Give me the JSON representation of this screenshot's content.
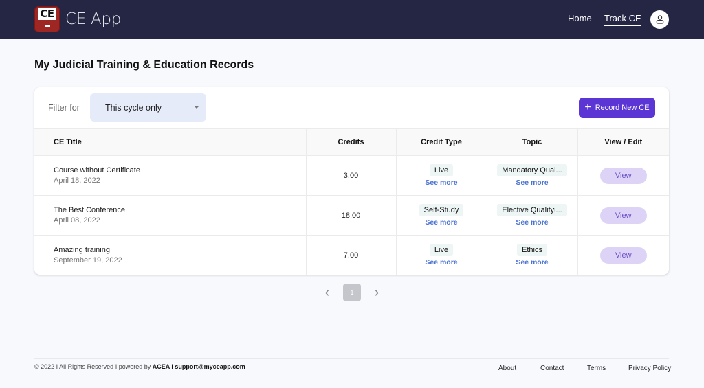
{
  "navbar": {
    "logo_text": "CE",
    "app_name": "CE App",
    "links": [
      {
        "label": "Home",
        "active": false
      },
      {
        "label": "Track CE",
        "active": true
      }
    ],
    "avatar_icon": "user-icon"
  },
  "page": {
    "title": "My Judicial Training & Education Records"
  },
  "filter": {
    "label": "Filter for",
    "selected": "This cycle only"
  },
  "actions": {
    "record_new_label": "Record New CE",
    "record_new_icon": "plus-icon"
  },
  "table": {
    "headers": [
      "CE Title",
      "Credits",
      "Credit Type",
      "Topic",
      "View / Edit"
    ],
    "rows": [
      {
        "title": "Course without Certificate",
        "date": "April 18, 2022",
        "credits": "3.00",
        "credit_type": "Live",
        "topic": "Mandatory Qual...",
        "see_more": "See more",
        "action": "View"
      },
      {
        "title": "The Best Conference",
        "date": "April 08, 2022",
        "credits": "18.00",
        "credit_type": "Self-Study",
        "topic": "Elective Qualifyi...",
        "see_more": "See more",
        "action": "View"
      },
      {
        "title": "Amazing training",
        "date": "September 19, 2022",
        "credits": "7.00",
        "credit_type": "Live",
        "topic": "Ethics",
        "see_more": "See more",
        "action": "View"
      }
    ]
  },
  "pagination": {
    "current_page": "1",
    "prev_icon": "chevron-left-icon",
    "next_icon": "chevron-right-icon"
  },
  "footer": {
    "copyright": "© 2022 I All Rights Reserved I powered by ",
    "company": "ACEA I support@myceapp.com",
    "links": [
      "About",
      "Contact",
      "Terms",
      "Privacy Policy"
    ]
  },
  "colors": {
    "navbar": "#242644",
    "primary": "#5b36d4",
    "link": "#4a72d2",
    "view_button": "#ddd3f6",
    "filter_bg": "#e6ebfa",
    "logo": "#9e2623"
  }
}
